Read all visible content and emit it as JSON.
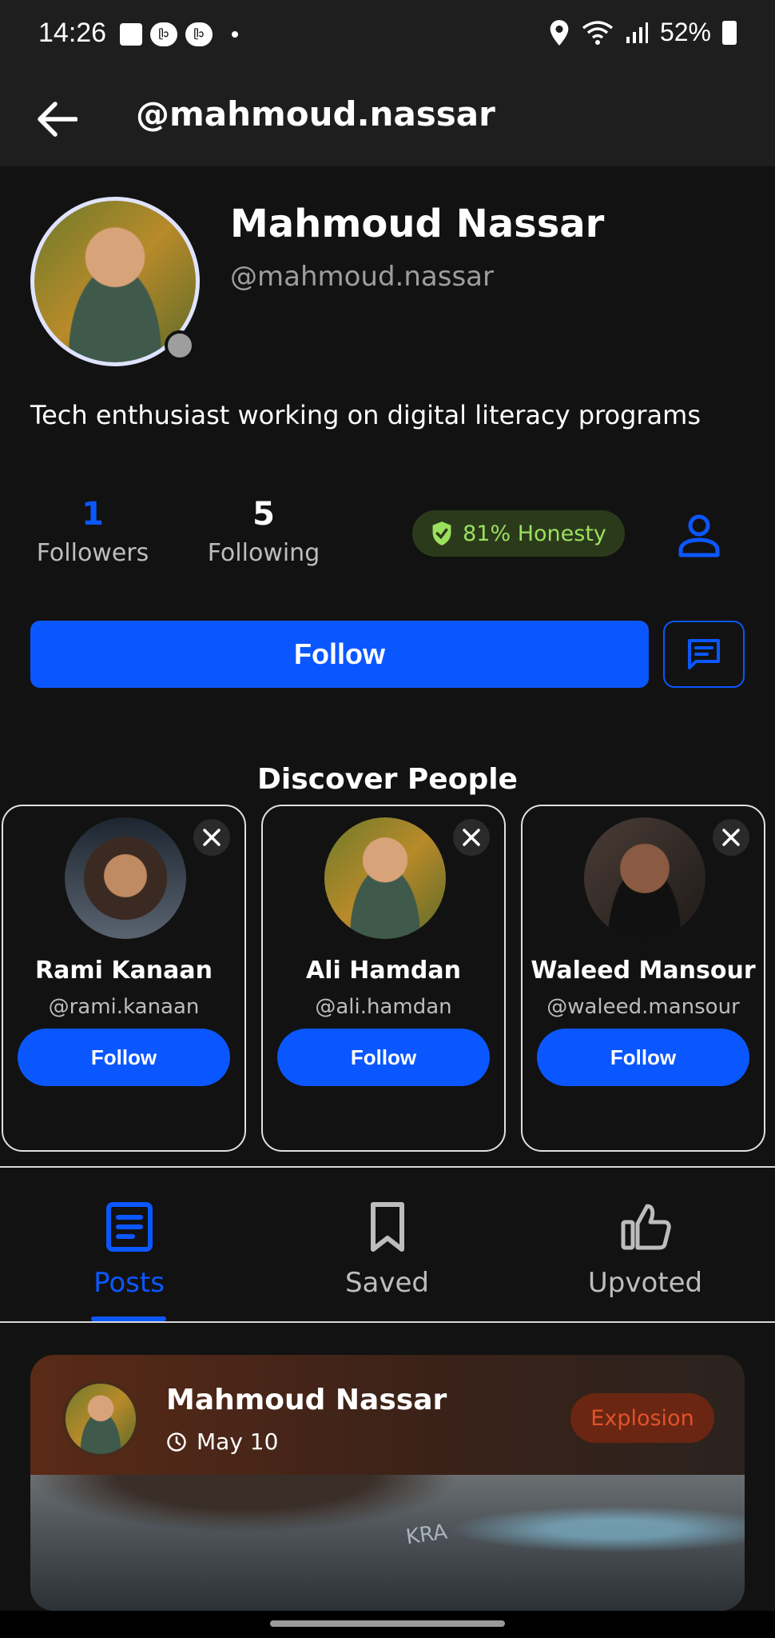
{
  "status_bar": {
    "time": "14:26",
    "battery": "52%",
    "notif_badge": "ᥫᩣ"
  },
  "app_bar": {
    "title": "@mahmoud.nassar"
  },
  "profile": {
    "name": "Mahmoud Nassar",
    "handle": "@mahmoud.nassar",
    "bio": "Tech enthusiast working on digital literacy programs",
    "followers_count": "1",
    "followers_label": "Followers",
    "following_count": "5",
    "following_label": "Following",
    "honesty": "81% Honesty",
    "follow_label": "Follow"
  },
  "discover": {
    "title": "Discover People",
    "people": [
      {
        "name": "Rami Kanaan",
        "handle": "@rami.kanaan",
        "follow_label": "Follow"
      },
      {
        "name": "Ali Hamdan",
        "handle": "@ali.hamdan",
        "follow_label": "Follow"
      },
      {
        "name": "Waleed Mansour",
        "handle": "@waleed.mansour",
        "follow_label": "Follow"
      }
    ]
  },
  "tabs": [
    {
      "label": "Posts",
      "active": true
    },
    {
      "label": "Saved",
      "active": false
    },
    {
      "label": "Upvoted",
      "active": false
    }
  ],
  "post": {
    "author": "Mahmoud Nassar",
    "date": "May 10",
    "tag": "Explosion",
    "image_text": "KRA"
  },
  "colors": {
    "accent": "#0b57ff",
    "background": "#121212",
    "honesty_text": "#9be15d",
    "tag_text": "#e2522a"
  }
}
